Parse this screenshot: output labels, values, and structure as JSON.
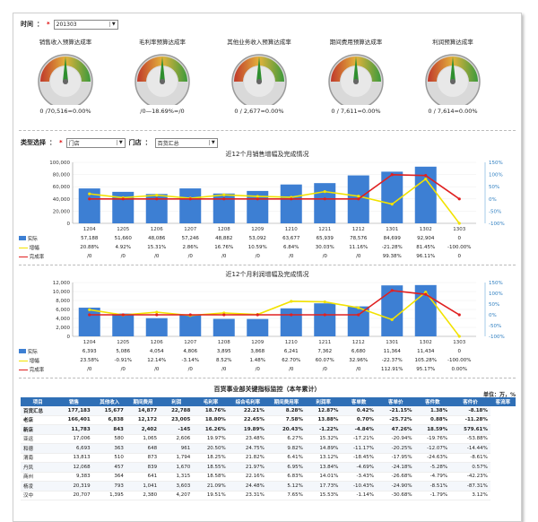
{
  "filters": {
    "time_label": "时间",
    "required_mark": "*",
    "time_value": "201303",
    "biz_label": "类型选择",
    "biz_value": "门店",
    "store_label": "门店",
    "store_value": "百货汇总"
  },
  "gauges": [
    {
      "title": "销售收入预算达成率",
      "value": "0 /70,516=0.00%"
    },
    {
      "title": "毛利率预算达成率",
      "value": "/0—18.69%=/0"
    },
    {
      "title": "其他业务收入预算达成率",
      "value": "0 / 2,677=0.00%"
    },
    {
      "title": "期间费用预算达成率",
      "value": "0 / 7,611=0.00%"
    },
    {
      "title": "利润预算达成率",
      "value": "0 / 7,614=0.00%"
    }
  ],
  "chart_data": [
    {
      "type": "bar",
      "title": "近12个月销售增幅及完成情况",
      "categories": [
        "1204",
        "1205",
        "1206",
        "1207",
        "1208",
        "1209",
        "1210",
        "1211",
        "1212",
        "1301",
        "1302",
        "1303"
      ],
      "y_ticks": [
        "100,000",
        "80,000",
        "60,000",
        "40,000",
        "20,000",
        "0"
      ],
      "y2_ticks": [
        "150%",
        "100%",
        "50%",
        "0%",
        "-50%",
        "-100%"
      ],
      "ylim": [
        0,
        100000
      ],
      "y2lim": [
        -100,
        150
      ],
      "series": [
        {
          "name": "实际",
          "values": [
            57188,
            51660,
            48086,
            57246,
            48882,
            53092,
            63677,
            65939,
            78576,
            84699,
            92904,
            0
          ],
          "labels": [
            "57,188",
            "51,660",
            "48,086",
            "57,246",
            "48,882",
            "53,092",
            "63,677",
            "65,939",
            "78,576",
            "84,699",
            "92,904",
            "0"
          ]
        },
        {
          "name": "增幅",
          "values": [
            20.88,
            4.92,
            15.31,
            2.86,
            16.76,
            10.59,
            6.84,
            30.03,
            11.16,
            -21.28,
            81.45,
            -100
          ],
          "labels": [
            "20.88%",
            "4.92%",
            "15.31%",
            "2.86%",
            "16.76%",
            "10.59%",
            "6.84%",
            "30.03%",
            "11.16%",
            "-21.28%",
            "81.45%",
            "-100.00%"
          ]
        },
        {
          "name": "完成率",
          "values": [
            0,
            0,
            0,
            0,
            0,
            0,
            0,
            0,
            0,
            99.38,
            96.11,
            0
          ],
          "labels": [
            "/0",
            "/0",
            "/0",
            "/0",
            "/0",
            "/0",
            "/0",
            "/0",
            "/0",
            "99.38%",
            "96.11%",
            "0"
          ]
        }
      ]
    },
    {
      "type": "bar",
      "title": "近12个月利润增幅及完成情况",
      "categories": [
        "1204",
        "1205",
        "1206",
        "1207",
        "1208",
        "1209",
        "1210",
        "1211",
        "1212",
        "1301",
        "1302",
        "1303"
      ],
      "y_ticks": [
        "12,000",
        "10,000",
        "8,000",
        "6,000",
        "4,000",
        "2,000",
        "0"
      ],
      "y2_ticks": [
        "150%",
        "100%",
        "50%",
        "0%",
        "-50%",
        "-100%"
      ],
      "ylim": [
        0,
        12000
      ],
      "y2lim": [
        -100,
        150
      ],
      "series": [
        {
          "name": "实际",
          "values": [
            6393,
            5086,
            4054,
            4806,
            3895,
            3868,
            6241,
            7362,
            6680,
            11364,
            11434,
            0
          ],
          "labels": [
            "6,393",
            "5,086",
            "4,054",
            "4,806",
            "3,895",
            "3,868",
            "6,241",
            "7,362",
            "6,680",
            "11,364",
            "11,434",
            "0"
          ]
        },
        {
          "name": "增幅",
          "values": [
            23.58,
            -0.91,
            12.14,
            -3.14,
            8.52,
            1.48,
            62.7,
            60.07,
            32.96,
            -22.37,
            105.28,
            -100
          ],
          "labels": [
            "23.58%",
            "-0.91%",
            "12.14%",
            "-3.14%",
            "8.52%",
            "1.48%",
            "62.70%",
            "60.07%",
            "32.96%",
            "-22.37%",
            "105.28%",
            "-100.00%"
          ]
        },
        {
          "name": "完成率",
          "values": [
            0,
            0,
            0,
            0,
            0,
            0,
            0,
            0,
            0,
            112.91,
            95.17,
            0
          ],
          "labels": [
            "/0",
            "/0",
            "/0",
            "/0",
            "/0",
            "/0",
            "/0",
            "/0",
            "/0",
            "112.91%",
            "95.17%",
            "0.00%"
          ]
        }
      ]
    }
  ],
  "kpi": {
    "title": "百货事业部关键指标监控（本年累计）",
    "unit": "单位：万，%",
    "headers": [
      "项目",
      "销售",
      "其他收入",
      "期间费用",
      "利润",
      "毛利率",
      "综合毛利率",
      "期间费用率",
      "利润率",
      "客单数",
      "客单价",
      "客件数",
      "客件价",
      "客流率"
    ],
    "rows": [
      {
        "bold": true,
        "cells": [
          "百货汇总",
          "177,183",
          "15,677",
          "14,877",
          "22,788",
          "18.76%",
          "22.21%",
          "8.28%",
          "12.87%",
          "0.42%",
          "-21.15%",
          "1.38%",
          "-8.18%"
        ]
      },
      {
        "bold": true,
        "cells": [
          "老店",
          "166,401",
          "6,838",
          "12,172",
          "23,005",
          "18.80%",
          "22.45%",
          "7.58%",
          "13.88%",
          "0.70%",
          "-25.72%",
          "0.88%",
          "-11.28%"
        ]
      },
      {
        "bold": true,
        "cells": [
          "新店",
          "11,783",
          "843",
          "2,402",
          "-145",
          "16.26%",
          "19.89%",
          "20.43%",
          "-1.22%",
          "-4.84%",
          "47.26%",
          "18.59%",
          "579.61%"
        ]
      },
      {
        "bold": false,
        "cells": [
          "亚运",
          "17,006",
          "580",
          "1,065",
          "2,606",
          "19.97%",
          "23.48%",
          "6.27%",
          "15.32%",
          "-17.21%",
          "-20.94%",
          "-19.76%",
          "-53.88%"
        ]
      },
      {
        "bold": false,
        "cells": [
          "和德",
          "6,693",
          "363",
          "648",
          "961",
          "20.50%",
          "24.75%",
          "9.82%",
          "14.89%",
          "-11.17%",
          "-20.25%",
          "-12.07%",
          "-14.44%"
        ]
      },
      {
        "bold": false,
        "cells": [
          "渭南",
          "13,813",
          "510",
          "873",
          "1,794",
          "18.25%",
          "21.82%",
          "6.41%",
          "13.12%",
          "-18.45%",
          "-17.95%",
          "-24.63%",
          "-8.61%"
        ]
      },
      {
        "bold": false,
        "cells": [
          "丹凤",
          "12,068",
          "457",
          "839",
          "1,670",
          "18.55%",
          "21.97%",
          "6.95%",
          "13.84%",
          "-4.69%",
          "-24.18%",
          "-5.28%",
          "0.57%"
        ]
      },
      {
        "bold": false,
        "cells": [
          "商州",
          "9,383",
          "364",
          "641",
          "1,315",
          "18.58%",
          "22.16%",
          "6.83%",
          "14.01%",
          "-3.43%",
          "-26.68%",
          "-4.79%",
          "-42.23%"
        ]
      },
      {
        "bold": false,
        "cells": [
          "杨凌",
          "20,319",
          "793",
          "1,041",
          "3,603",
          "21.09%",
          "24.48%",
          "5.12%",
          "17.73%",
          "-10.43%",
          "-24.90%",
          "-8.51%",
          "-87.31%"
        ]
      },
      {
        "bold": false,
        "cells": [
          "汉中",
          "20,707",
          "1,395",
          "2,380",
          "4,207",
          "19.51%",
          "23.31%",
          "7.65%",
          "15.53%",
          "-1.14%",
          "-30.68%",
          "-1.79%",
          "3.12%"
        ]
      }
    ]
  }
}
